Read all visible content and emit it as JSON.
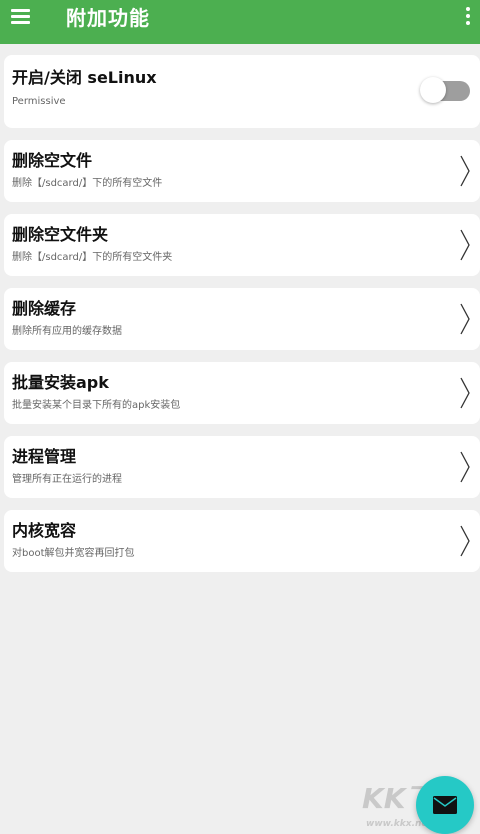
{
  "appbar": {
    "title": "附加功能",
    "color": "#4caf50"
  },
  "selinux": {
    "title": "开启/关闭 seLinux",
    "status": "Permissive",
    "enabled": false
  },
  "items": [
    {
      "title": "删除空文件",
      "subtitle": "删除【/sdcard/】下的所有空文件"
    },
    {
      "title": "删除空文件夹",
      "subtitle": "删除【/sdcard/】下的所有空文件夹"
    },
    {
      "title": "删除缓存",
      "subtitle": "删除所有应用的缓存数据"
    },
    {
      "title": "批量安装apk",
      "subtitle": "批量安装某个目录下所有的apk安装包"
    },
    {
      "title": "进程管理",
      "subtitle": "管理所有正在运行的进程"
    },
    {
      "title": "内核宽容",
      "subtitle": "对boot解包并宽容再回打包"
    }
  ],
  "fab": {
    "icon": "mail-icon",
    "color": "#25c9c6"
  },
  "watermark": {
    "big": "KK下载",
    "small": "www.kkx.net"
  }
}
